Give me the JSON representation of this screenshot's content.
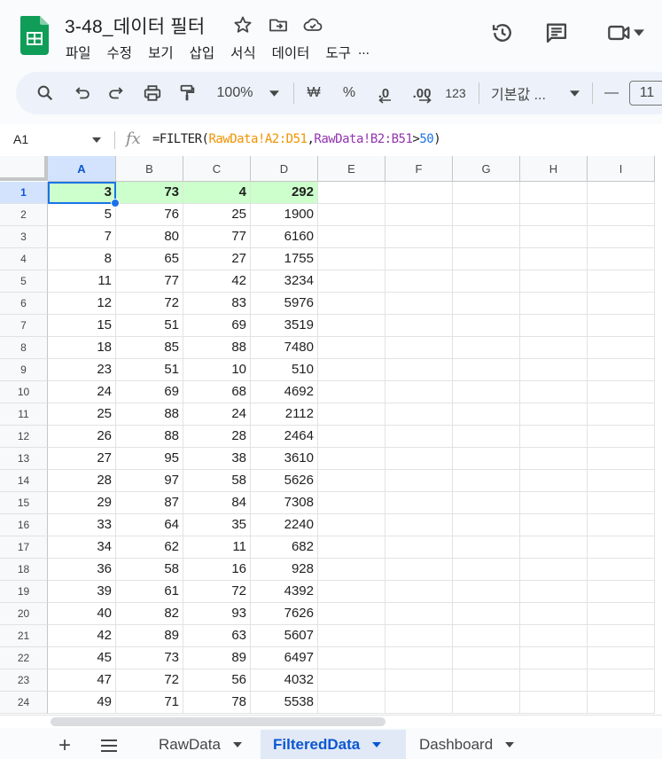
{
  "app": {
    "title": "3-48_데이터 필터",
    "menu": [
      "파일",
      "수정",
      "보기",
      "삽입",
      "서식",
      "데이터",
      "도구",
      "..."
    ]
  },
  "toolbar": {
    "zoom": "100%",
    "currency": "₩",
    "percent": "%",
    "decimal_decrease": ".0",
    "decimal_increase": ".00",
    "number_format": "123",
    "font": "기본값 ...",
    "minus": "—",
    "font_size": "11"
  },
  "formula_bar": {
    "name_box": "A1",
    "fx": "fx",
    "formula_prefix": "=FILTER(",
    "ref1": "RawData!A2:D51",
    "comma": ",",
    "ref2": "RawData!B2:B51",
    "gt": ">",
    "num": "50",
    "close": ")"
  },
  "grid": {
    "columns": [
      "A",
      "B",
      "C",
      "D",
      "E",
      "F",
      "G",
      "H",
      "I"
    ],
    "row_numbers": [
      "1",
      "2",
      "3",
      "4",
      "5",
      "6",
      "7",
      "8",
      "9",
      "10",
      "11",
      "12",
      "13",
      "14",
      "15",
      "16",
      "17",
      "18",
      "19",
      "20",
      "21",
      "22",
      "23",
      "24"
    ],
    "rows": [
      [
        "3",
        "73",
        "4",
        "292"
      ],
      [
        "5",
        "76",
        "25",
        "1900"
      ],
      [
        "7",
        "80",
        "77",
        "6160"
      ],
      [
        "8",
        "65",
        "27",
        "1755"
      ],
      [
        "11",
        "77",
        "42",
        "3234"
      ],
      [
        "12",
        "72",
        "83",
        "5976"
      ],
      [
        "15",
        "51",
        "69",
        "3519"
      ],
      [
        "18",
        "85",
        "88",
        "7480"
      ],
      [
        "23",
        "51",
        "10",
        "510"
      ],
      [
        "24",
        "69",
        "68",
        "4692"
      ],
      [
        "25",
        "88",
        "24",
        "2112"
      ],
      [
        "26",
        "88",
        "28",
        "2464"
      ],
      [
        "27",
        "95",
        "38",
        "3610"
      ],
      [
        "28",
        "97",
        "58",
        "5626"
      ],
      [
        "29",
        "87",
        "84",
        "7308"
      ],
      [
        "33",
        "64",
        "35",
        "2240"
      ],
      [
        "34",
        "62",
        "11",
        "682"
      ],
      [
        "36",
        "58",
        "16",
        "928"
      ],
      [
        "39",
        "61",
        "72",
        "4392"
      ],
      [
        "40",
        "82",
        "93",
        "7626"
      ],
      [
        "42",
        "89",
        "63",
        "5607"
      ],
      [
        "45",
        "73",
        "89",
        "6497"
      ],
      [
        "47",
        "72",
        "56",
        "4032"
      ],
      [
        "49",
        "71",
        "78",
        "5538"
      ]
    ]
  },
  "sheets": {
    "tabs": [
      "RawData",
      "FilteredData",
      "Dashboard"
    ],
    "active": "FilteredData",
    "add": "+",
    "list": "≡"
  },
  "colors": {
    "header_row_fill": "#ccffcc",
    "selection": "#1a73e8",
    "logo": "#0f9d58"
  }
}
